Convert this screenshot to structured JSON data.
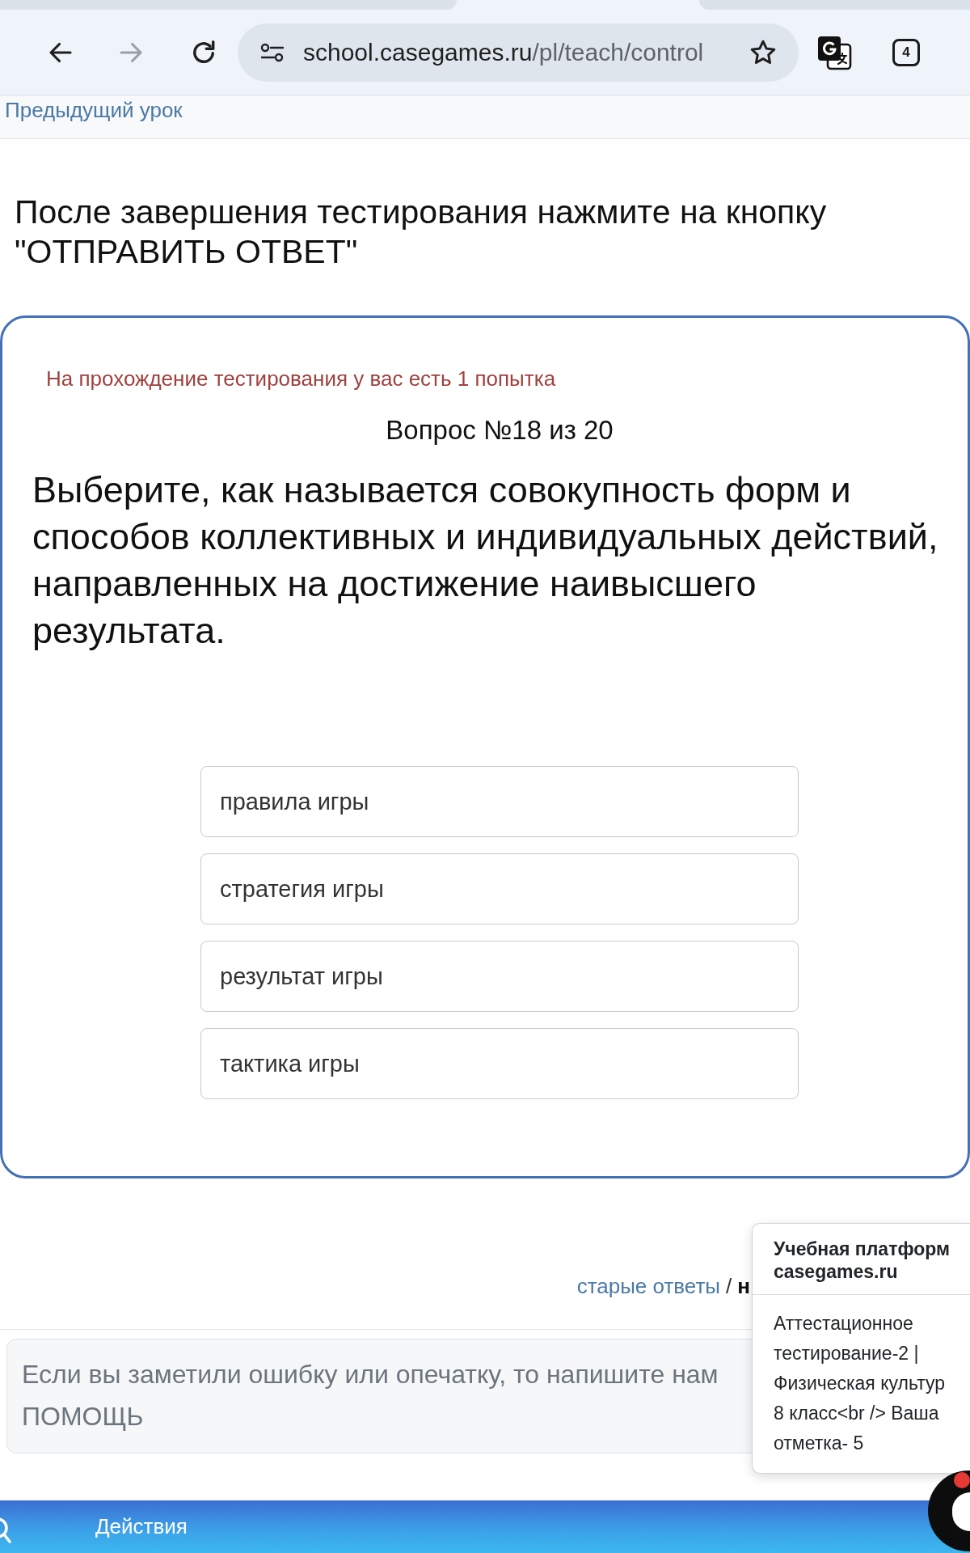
{
  "browser": {
    "url_host": "school.casegames.ru",
    "url_path": "/pl/teach/control",
    "forward_disabled": true,
    "tab_count": "4"
  },
  "nav": {
    "previous_lesson": "Предыдущий урок"
  },
  "instruction": "После завершения тестирования нажмите на кнопку \"ОТПРАВИТЬ ОТВЕТ\"",
  "test_card": {
    "attempts_note": "На прохождение тестирования у вас есть 1 попытка",
    "progress": "Вопрос №18 из 20",
    "question": "Выберите, как называется совокупность форм и способов коллективных и индивидуальных действий, направленных на достижение наивысшего результата.",
    "options": [
      {
        "label": "правила игры",
        "selected": false
      },
      {
        "label": "стратегия игры",
        "selected": false
      },
      {
        "label": "результат игры",
        "selected": false
      },
      {
        "label": "тактика игры",
        "selected": false
      }
    ]
  },
  "answers_links": {
    "old_answers": "старые ответы",
    "separator": "/",
    "link_2": "н"
  },
  "feedback": {
    "placeholder": "Если вы заметили ошибку или опечатку, то напишите нам\nПОМОЩЬ"
  },
  "notification": {
    "title": "Учебная платформ\ncasegames.ru",
    "body": "Аттестационное\nтестирование-2 |\nФизическая культур\n8 класс<br /> Ваша\nотметка- 5"
  },
  "chat": {
    "unread": true
  },
  "bottom_bar": {
    "label": "Действия"
  }
}
